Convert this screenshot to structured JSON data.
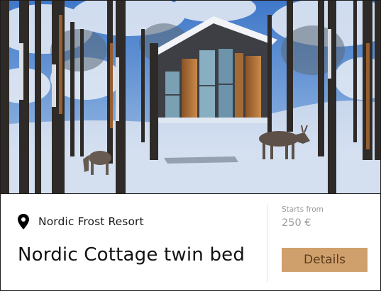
{
  "card": {
    "location": "Nordic Frost Resort",
    "title": "Nordic Cottage twin bed",
    "price_caption": "Starts from",
    "price": "250 €",
    "button_label": "Details"
  },
  "icons": {
    "location": "location-pin-icon"
  },
  "colors": {
    "button_bg": "#d0a06c",
    "button_text": "#5a3d1c",
    "muted_text": "#9b9b9b",
    "border": "#1d1d1d"
  }
}
